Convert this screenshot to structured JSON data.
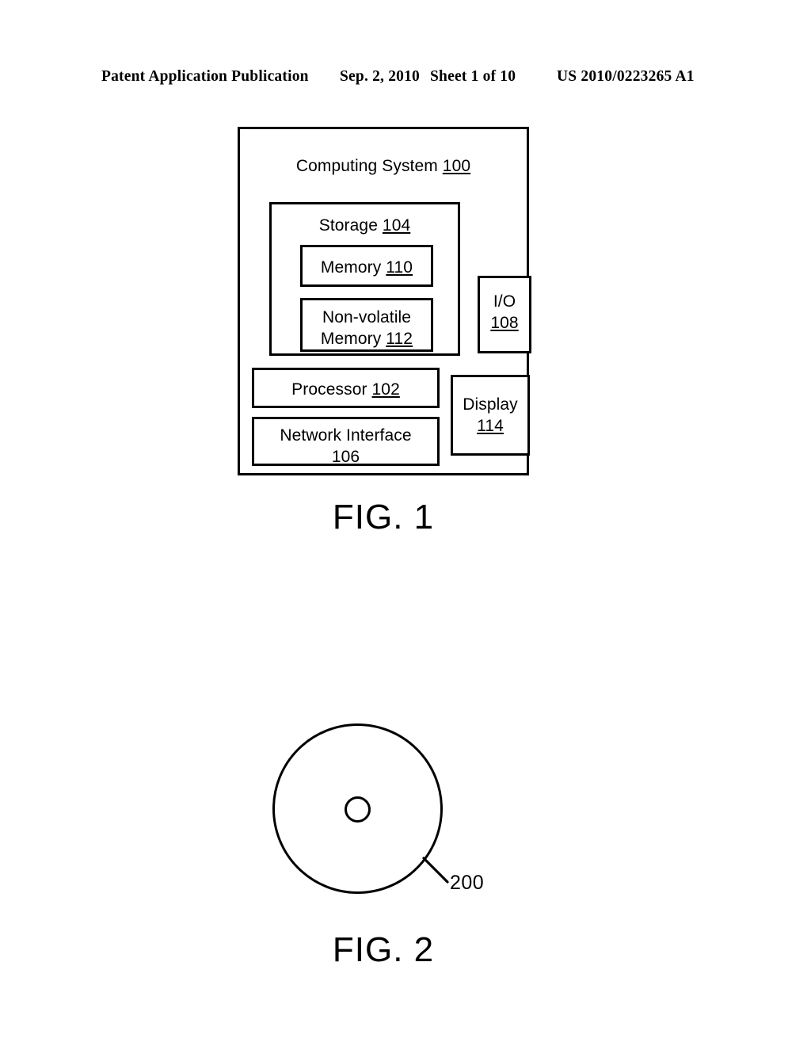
{
  "header": {
    "publication": "Patent Application Publication",
    "date": "Sep. 2, 2010",
    "sheet": "Sheet 1 of 10",
    "publication_number": "US 2010/0223265 A1"
  },
  "figure1": {
    "caption": "FIG. 1",
    "system": {
      "label": "Computing System",
      "ref": "100"
    },
    "storage": {
      "label": "Storage",
      "ref": "104"
    },
    "memory": {
      "label": "Memory",
      "ref": "110"
    },
    "nonvolatile_memory": {
      "label_line1": "Non-volatile",
      "label_line2": "Memory",
      "ref": "112"
    },
    "processor": {
      "label": "Processor",
      "ref": "102"
    },
    "network_interface": {
      "label": "Network Interface",
      "ref": "106"
    },
    "io": {
      "label": "I/O",
      "ref": "108"
    },
    "display": {
      "label": "Display",
      "ref": "114"
    }
  },
  "figure2": {
    "caption": "FIG. 2",
    "disc": {
      "ref": "200"
    }
  }
}
